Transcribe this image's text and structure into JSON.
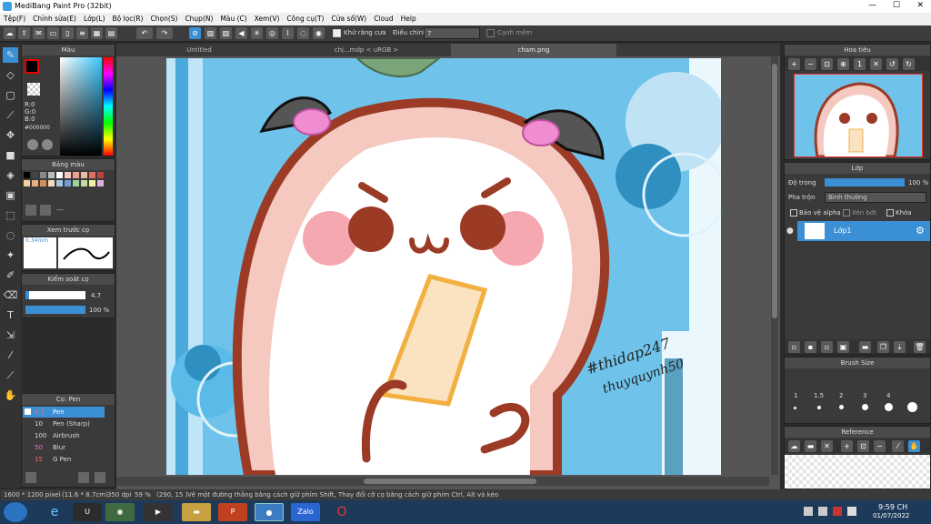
{
  "window": {
    "title": "MediBang Paint Pro (32bit)"
  },
  "menu": [
    "Tệp(F)",
    "Chỉnh sửa(E)",
    "Lớp(L)",
    "Bộ lọc(R)",
    "Chọn(S)",
    "Chụp(N)",
    "Màu (C)",
    "Xem(V)",
    "Công cụ(T)",
    "Cửa sổ(W)",
    "Cloud",
    "Help"
  ],
  "toolbar": {
    "antialias_label": "Khử răng cưa",
    "correction_label": "Điều chỉnh",
    "correction_value": "7",
    "sharp_edge_label": "Cạnh mềm"
  },
  "tabs": [
    "Untitled",
    "chị...mdp < uRGB >",
    "cham.png"
  ],
  "color_panel": {
    "title": "Màu",
    "r": "R:0",
    "g": "G:0",
    "b": "B:0",
    "hex": "#000000"
  },
  "palette_panel": {
    "title": "Bảng màu",
    "more": "---"
  },
  "preview_panel": {
    "title": "Xem trước cọ",
    "size": "0.34mm"
  },
  "control_panel": {
    "title": "Kiểm soát cọ",
    "size_value": "4.7",
    "opacity_value": "100 %"
  },
  "brush_panel": {
    "title": "Cọ: Pen",
    "items": [
      {
        "size": "4.7",
        "name": "Pen"
      },
      {
        "size": "10",
        "name": "Pen (Sharp)"
      },
      {
        "size": "100",
        "name": "Airbrush"
      },
      {
        "size": "50",
        "name": "Blur"
      },
      {
        "size": "15",
        "name": "G Pen"
      }
    ]
  },
  "navigator": {
    "title": "Hoa tiêu"
  },
  "layer_panel": {
    "title": "Lớp",
    "opacity_label": "Độ trong",
    "opacity_value": "100 %",
    "blend_label": "Pha trộn",
    "blend_value": "Bình thường",
    "protect_alpha": "Bảo vệ alpha",
    "clip": "Xén bớt",
    "lock": "Khóa",
    "layer_name": "Lớp1"
  },
  "brush_size_panel": {
    "title": "Brush Size",
    "sizes": [
      "1",
      "1.5",
      "2",
      "3",
      "4"
    ]
  },
  "reference_panel": {
    "title": "Reference"
  },
  "status": {
    "size": "1600 * 1200 pixel",
    "cm": "(11.6 * 8.7cm)",
    "dpi": "350 dpi",
    "zoom": "59 %",
    "coords": "(290, 15 )",
    "hint": "Vẽ một đường thẳng bằng cách giữ phím Shift, Thay đổi cỡ cọ bằng cách giữ phím Ctrl, Alt và kéo"
  },
  "taskbar": {
    "time": "9:59 CH",
    "date": "01/07/2022",
    "zalo": "Zalo"
  },
  "artwork": {
    "hashtag": "#thidap247",
    "signature": "thuyquynh50"
  },
  "colors": {
    "accent": "#3b8fd4",
    "canvas_bg": "#6fc3ea",
    "brown": "#9b3a25",
    "pink": "#f5a8b0"
  }
}
